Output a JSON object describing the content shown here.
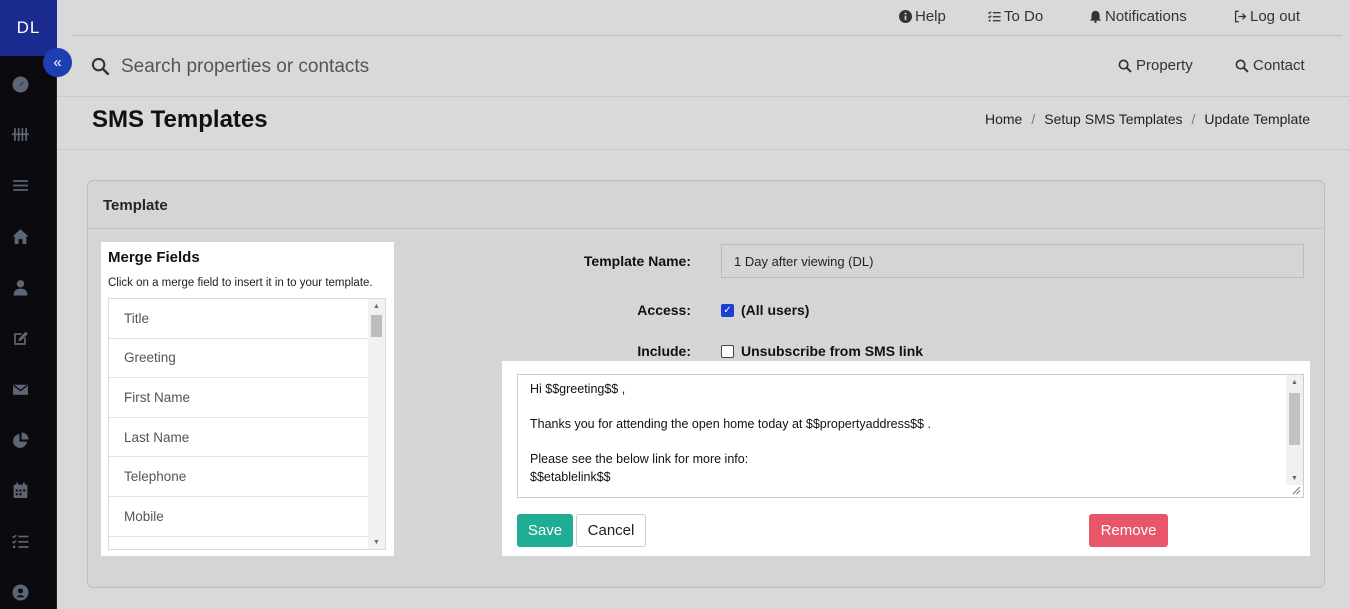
{
  "sidebar": {
    "logo": "DL",
    "collapse_glyph": "«",
    "icons": [
      "dashboard-icon",
      "tally-icon",
      "list-icon",
      "home-icon",
      "user-icon",
      "edit-icon",
      "envelope-icon",
      "pie-chart-icon",
      "calendar-icon",
      "tasks-icon",
      "contact-icon"
    ]
  },
  "topnav": {
    "help": "Help",
    "todo": "To Do",
    "notifications": "Notifications",
    "logout": "Log out"
  },
  "search": {
    "placeholder": "Search properties or contacts",
    "property_label": "Property",
    "contact_label": "Contact"
  },
  "page": {
    "title": "SMS Templates",
    "breadcrumb": [
      "Home",
      "Setup SMS Templates",
      "Update Template"
    ],
    "breadcrumb_sep": "/"
  },
  "card": {
    "title": "Template"
  },
  "merge": {
    "title": "Merge Fields",
    "hint": "Click on a merge field to insert it in to your template.",
    "items": [
      "Title",
      "Greeting",
      "First Name",
      "Last Name",
      "Telephone",
      "Mobile"
    ]
  },
  "form": {
    "name_label": "Template Name:",
    "name_value": "1 Day after viewing (DL)",
    "access_label": "Access:",
    "access_option": "(All users)",
    "access_checked": true,
    "include_label": "Include:",
    "include_option": "Unsubscribe from SMS link",
    "include_checked": false
  },
  "message": {
    "body": "Hi $$greeting$$ ,\n\nThanks you for attending the open home today at $$propertyaddress$$ .\n\nPlease see the below link for more info:\n$$etablelink$$"
  },
  "buttons": {
    "save": "Save",
    "cancel": "Cancel",
    "remove": "Remove"
  },
  "colors": {
    "sidebar_bg": "#0a0a0f",
    "logo_bg": "#1b2a8f",
    "save": "#1fad93",
    "remove": "#e8566a",
    "checkbox": "#1b3fd0"
  }
}
